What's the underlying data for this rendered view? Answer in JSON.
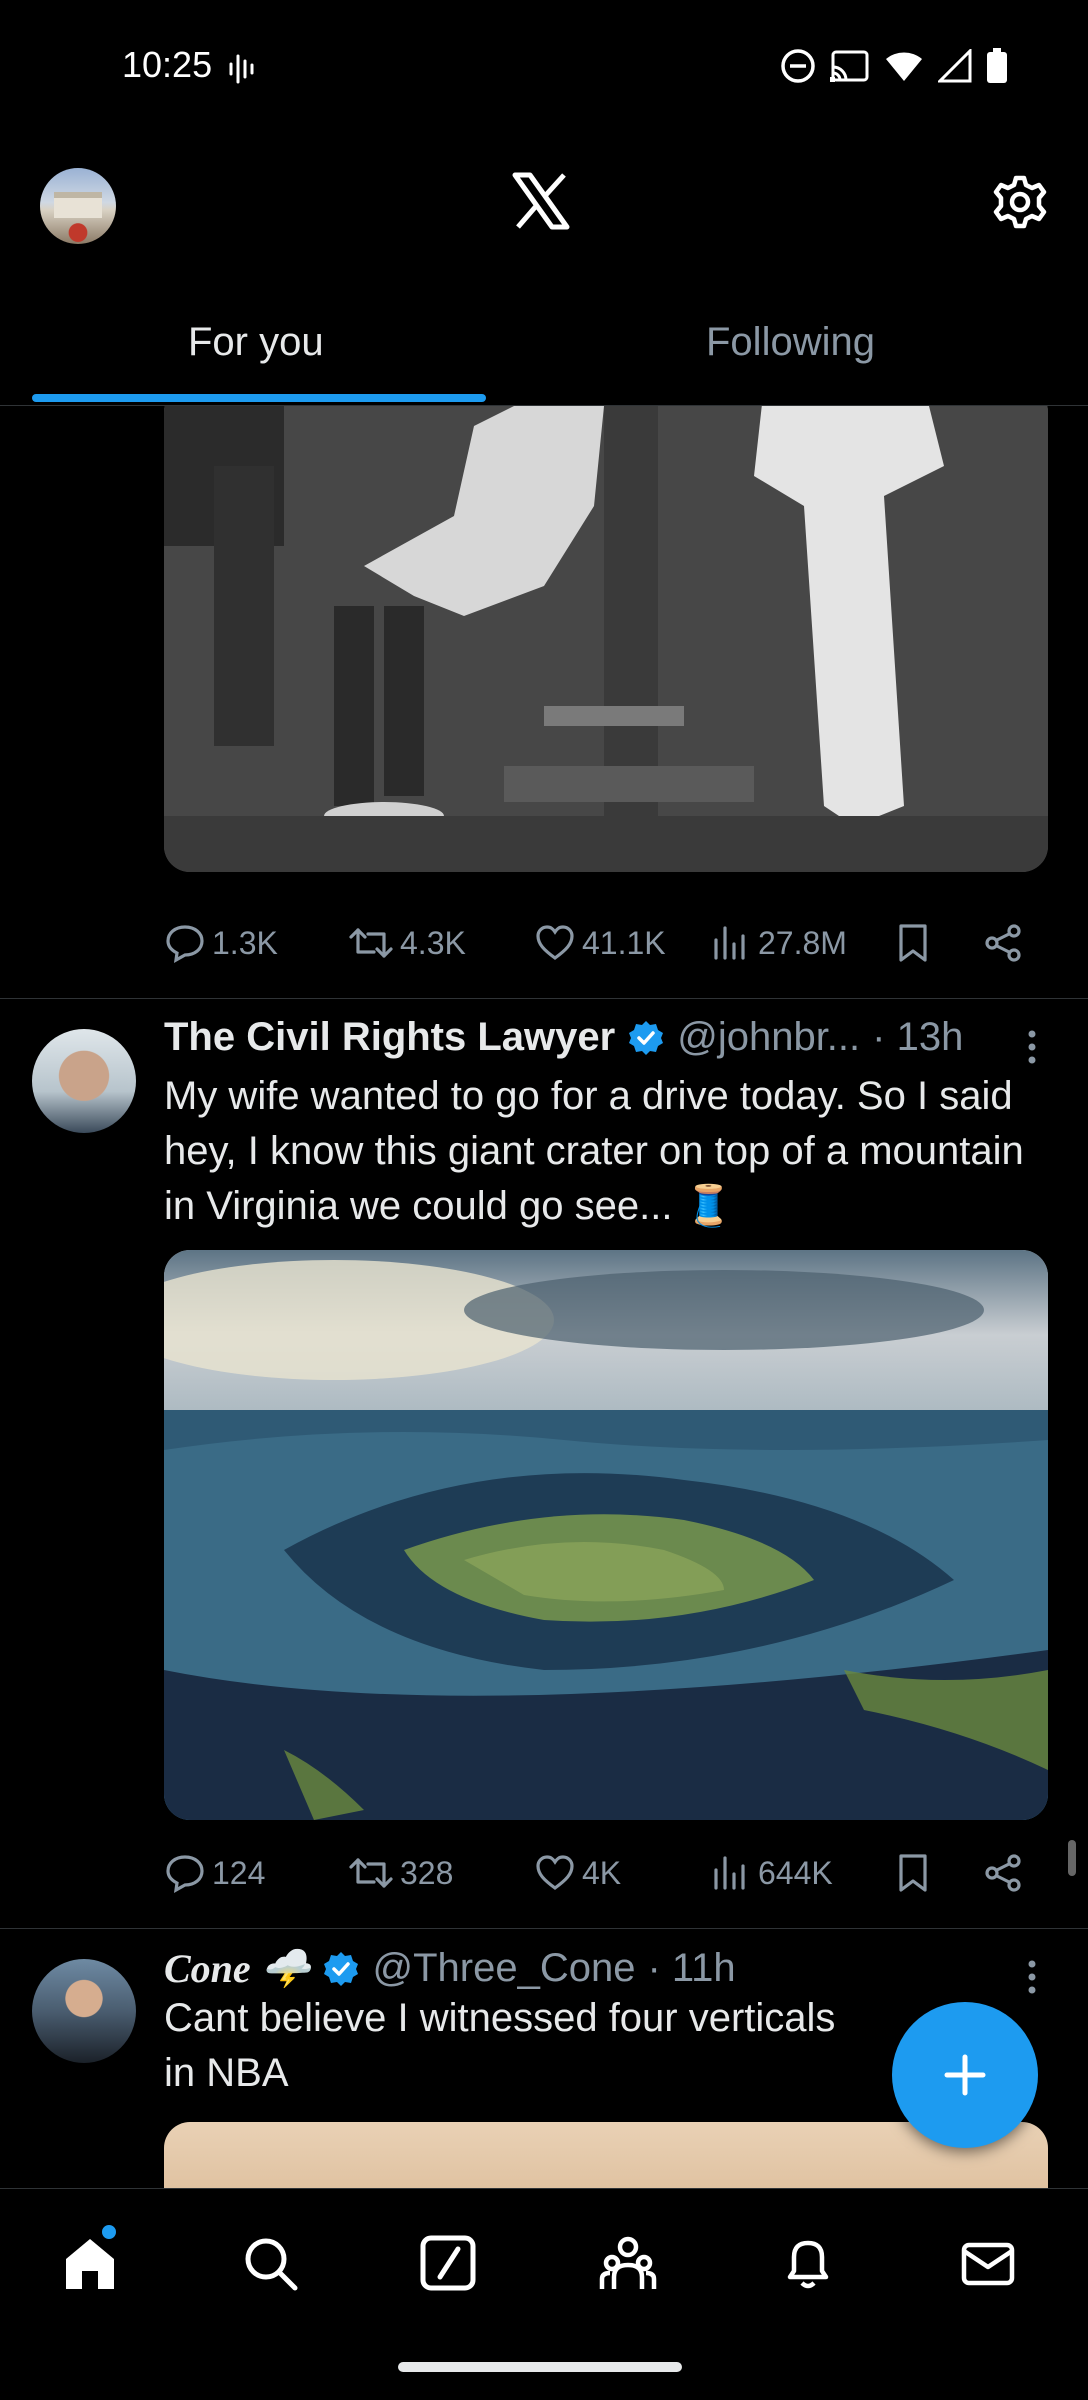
{
  "status_bar": {
    "time": "10:25",
    "icons": [
      "voice-wave-icon",
      "dnd-icon",
      "cast-icon",
      "wifi-icon",
      "signal-icon",
      "battery-icon"
    ]
  },
  "header": {
    "logo": "x-logo-icon",
    "settings_icon": "gear-icon"
  },
  "tabs": [
    {
      "label": "For you",
      "active": true
    },
    {
      "label": "Following",
      "active": false
    }
  ],
  "feed": {
    "tweet1": {
      "stats": {
        "replies": "1.3K",
        "reposts": "4.3K",
        "likes": "41.1K",
        "views": "27.8M"
      }
    },
    "tweet2": {
      "name": "The Civil Rights Lawyer",
      "verified": true,
      "handle": "@johnbr...",
      "time": "· 13h",
      "text": "My wife wanted to go for a drive today. So I said hey, I know this giant crater on top of a mountain in Virginia we could go see... 🧵",
      "stats": {
        "replies": "124",
        "reposts": "328",
        "likes": "4K",
        "views": "644K"
      }
    },
    "tweet3": {
      "name": "Cone 🌩️",
      "verified": true,
      "handle": "@Three_Cone",
      "time": "· 11h",
      "text": "Cant believe I witnessed four verticals in NBA"
    }
  },
  "fab": {
    "icon": "plus-icon"
  },
  "bottom_nav": [
    {
      "icon": "home-icon",
      "active": true,
      "notification_dot": true
    },
    {
      "icon": "search-icon"
    },
    {
      "icon": "grok-icon"
    },
    {
      "icon": "communities-icon"
    },
    {
      "icon": "bell-icon"
    },
    {
      "icon": "mail-icon"
    }
  ],
  "colors": {
    "accent": "#1d9bf0",
    "background": "#000000",
    "text": "#e7e9ea",
    "muted": "#8b98a5",
    "divider": "#2f3336"
  }
}
